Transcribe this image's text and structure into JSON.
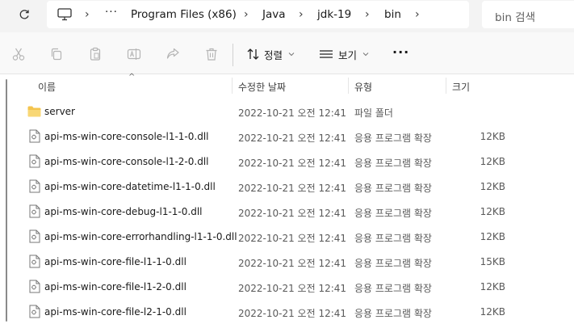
{
  "address": {
    "crumbs": [
      "Program Files (x86)",
      "Java",
      "jdk-19",
      "bin"
    ],
    "overflow": "···",
    "separator": "›",
    "search_placeholder": "bin 검색"
  },
  "toolbar": {
    "sort_label": "정렬",
    "view_label": "보기",
    "more_label": "···"
  },
  "columns": {
    "name": "이름",
    "modified": "수정한 날짜",
    "type": "유형",
    "size": "크기"
  },
  "files": [
    {
      "name": "server",
      "modified": "2022-10-21 오전 12:41",
      "type": "파일 폴더",
      "size": "",
      "kind": "folder"
    },
    {
      "name": "api-ms-win-core-console-l1-1-0.dll",
      "modified": "2022-10-21 오전 12:41",
      "type": "응용 프로그램 확장",
      "size": "12KB",
      "kind": "dll"
    },
    {
      "name": "api-ms-win-core-console-l1-2-0.dll",
      "modified": "2022-10-21 오전 12:41",
      "type": "응용 프로그램 확장",
      "size": "12KB",
      "kind": "dll"
    },
    {
      "name": "api-ms-win-core-datetime-l1-1-0.dll",
      "modified": "2022-10-21 오전 12:41",
      "type": "응용 프로그램 확장",
      "size": "12KB",
      "kind": "dll"
    },
    {
      "name": "api-ms-win-core-debug-l1-1-0.dll",
      "modified": "2022-10-21 오전 12:41",
      "type": "응용 프로그램 확장",
      "size": "12KB",
      "kind": "dll"
    },
    {
      "name": "api-ms-win-core-errorhandling-l1-1-0.dll",
      "modified": "2022-10-21 오전 12:41",
      "type": "응용 프로그램 확장",
      "size": "12KB",
      "kind": "dll"
    },
    {
      "name": "api-ms-win-core-file-l1-1-0.dll",
      "modified": "2022-10-21 오전 12:41",
      "type": "응용 프로그램 확장",
      "size": "15KB",
      "kind": "dll"
    },
    {
      "name": "api-ms-win-core-file-l1-2-0.dll",
      "modified": "2022-10-21 오전 12:41",
      "type": "응용 프로그램 확장",
      "size": "12KB",
      "kind": "dll"
    },
    {
      "name": "api-ms-win-core-file-l2-1-0.dll",
      "modified": "2022-10-21 오전 12:41",
      "type": "응용 프로그램 확장",
      "size": "12KB",
      "kind": "dll"
    }
  ],
  "icons": {
    "refresh": "refresh-icon",
    "pc": "computer-icon",
    "cut": "cut-icon",
    "copy": "copy-icon",
    "paste": "paste-icon",
    "rename": "rename-icon",
    "share": "share-icon",
    "delete": "delete-icon",
    "folder": "folder-icon",
    "dll": "dll-file-icon"
  },
  "colors": {
    "folder": "#f4c44e",
    "disabled_icon": "#b5b5b5",
    "header_bg": "#f3f3f3"
  }
}
